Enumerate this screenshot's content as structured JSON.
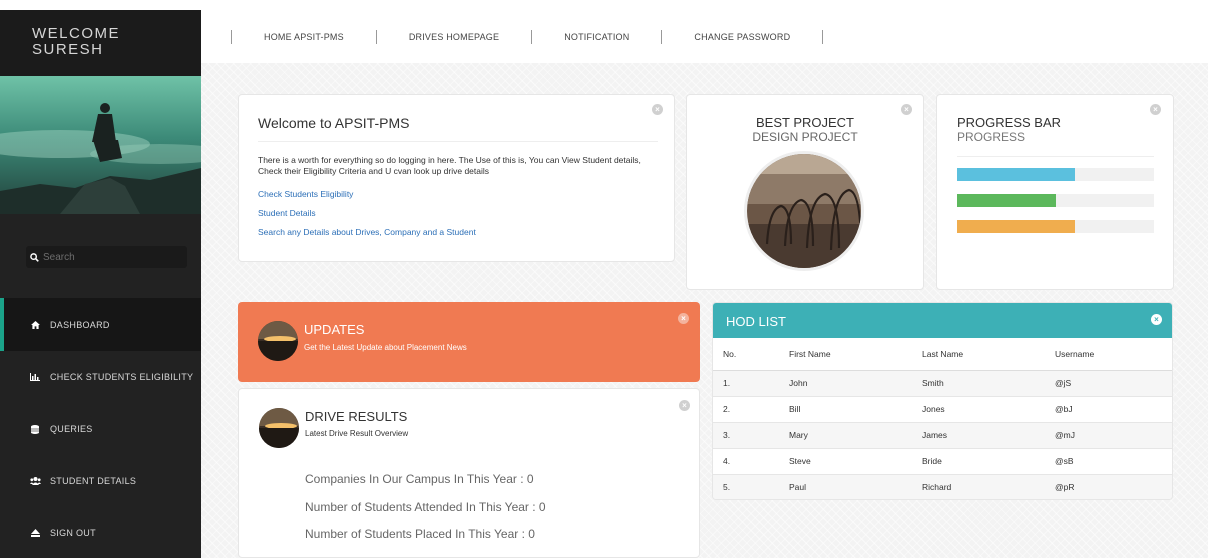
{
  "sidebar": {
    "welcome_line1": "WELCOME",
    "welcome_line2": "SURESH",
    "search_placeholder": "Search",
    "items": [
      {
        "label": "DASHBOARD",
        "icon": "home-icon",
        "active": true
      },
      {
        "label": "CHECK STUDENTS ELIGIBILITY",
        "icon": "bar-chart-icon",
        "active": false
      },
      {
        "label": "QUERIES",
        "icon": "database-icon",
        "active": false
      },
      {
        "label": "STUDENT DETAILS",
        "icon": "users-icon",
        "active": false
      },
      {
        "label": "SIGN OUT",
        "icon": "eject-icon",
        "active": false
      }
    ]
  },
  "topnav": {
    "items": [
      "HOME APSIT-PMS",
      "DRIVES HOMEPAGE",
      "NOTIFICATION",
      "CHANGE PASSWORD"
    ]
  },
  "welcome_panel": {
    "title": "Welcome to APSIT-PMS",
    "text": "There is a worth for everything so do logging in here. The Use of this is, You can View Student details, Check their Eligibility Criteria and U cvan look up drive details",
    "links": [
      "Check Students Eligibility",
      "Student Details",
      "Search any Details about Drives, Company and a Student"
    ]
  },
  "best_project": {
    "title": "BEST PROJECT",
    "subtitle": "DESIGN PROJECT"
  },
  "progress_panel": {
    "title": "PROGRESS BAR",
    "subtitle": "PROGRESS",
    "bars": [
      {
        "value": 0.6,
        "color": "#5bc0de"
      },
      {
        "value": 0.5,
        "color": "#5cb85c"
      },
      {
        "value": 0.6,
        "color": "#f0ad4e"
      }
    ]
  },
  "updates": {
    "title": "UPDATES",
    "subtitle": "Get the Latest Update about Placement News"
  },
  "drive_results": {
    "title": "DRIVE RESULTS",
    "subtitle": "Latest Drive Result Overview",
    "lines": [
      "Companies In Our Campus In This Year : 0",
      "Number of Students Attended In This Year : 0",
      "Number of Students Placed In This Year : 0"
    ]
  },
  "hod_list": {
    "title": "HOD LIST",
    "columns": [
      "No.",
      "First Name",
      "Last Name",
      "Username"
    ],
    "rows": [
      [
        "1.",
        "John",
        "Smith",
        "@jS"
      ],
      [
        "2.",
        "Bill",
        "Jones",
        "@bJ"
      ],
      [
        "3.",
        "Mary",
        "James",
        "@mJ"
      ],
      [
        "4.",
        "Steve",
        "Bride",
        "@sB"
      ],
      [
        "5.",
        "Paul",
        "Richard",
        "@pR"
      ]
    ]
  },
  "colors": {
    "accent": "#1ba38a",
    "updates": "#f07a52",
    "hod_header": "#3db0b6",
    "link": "#2c6fb7"
  }
}
